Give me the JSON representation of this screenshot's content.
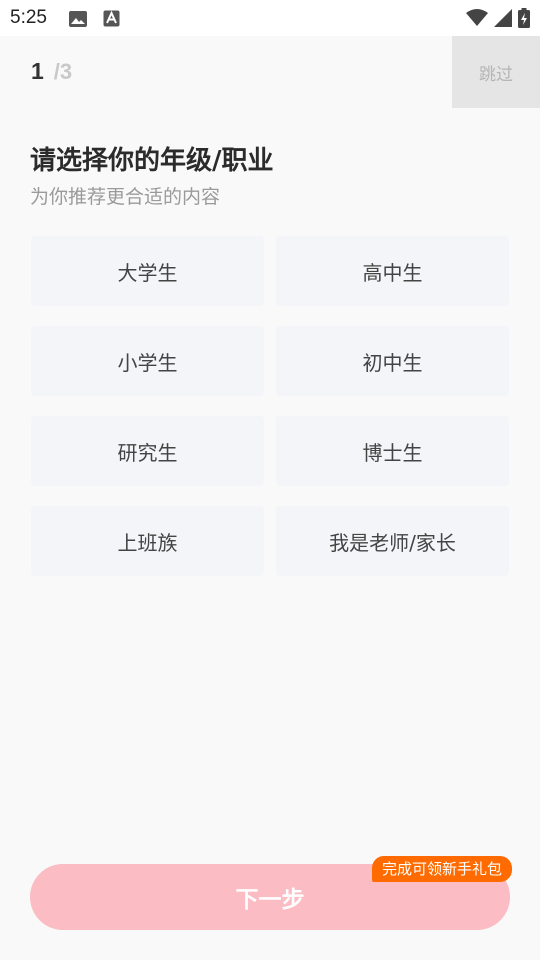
{
  "status_bar": {
    "time": "5:25",
    "icons": [
      "image-icon",
      "a-icon",
      "wifi-icon",
      "signal-icon",
      "battery-icon"
    ]
  },
  "progress": {
    "current": "1",
    "total": "/3"
  },
  "skip_label": "跳过",
  "title": "请选择你的年级/职业",
  "subtitle": "为你推荐更合适的内容",
  "options": [
    "大学生",
    "高中生",
    "小学生",
    "初中生",
    "研究生",
    "博士生",
    "上班族",
    "我是老师/家长"
  ],
  "next_label": "下一步",
  "gift_badge": "完成可领新手礼包",
  "colors": {
    "background": "#f9f9fa",
    "option_bg": "#f4f5f8",
    "next_button": "#fbbcc3",
    "badge": "#ff6b00",
    "skip_bg": "#e5e5e5"
  }
}
